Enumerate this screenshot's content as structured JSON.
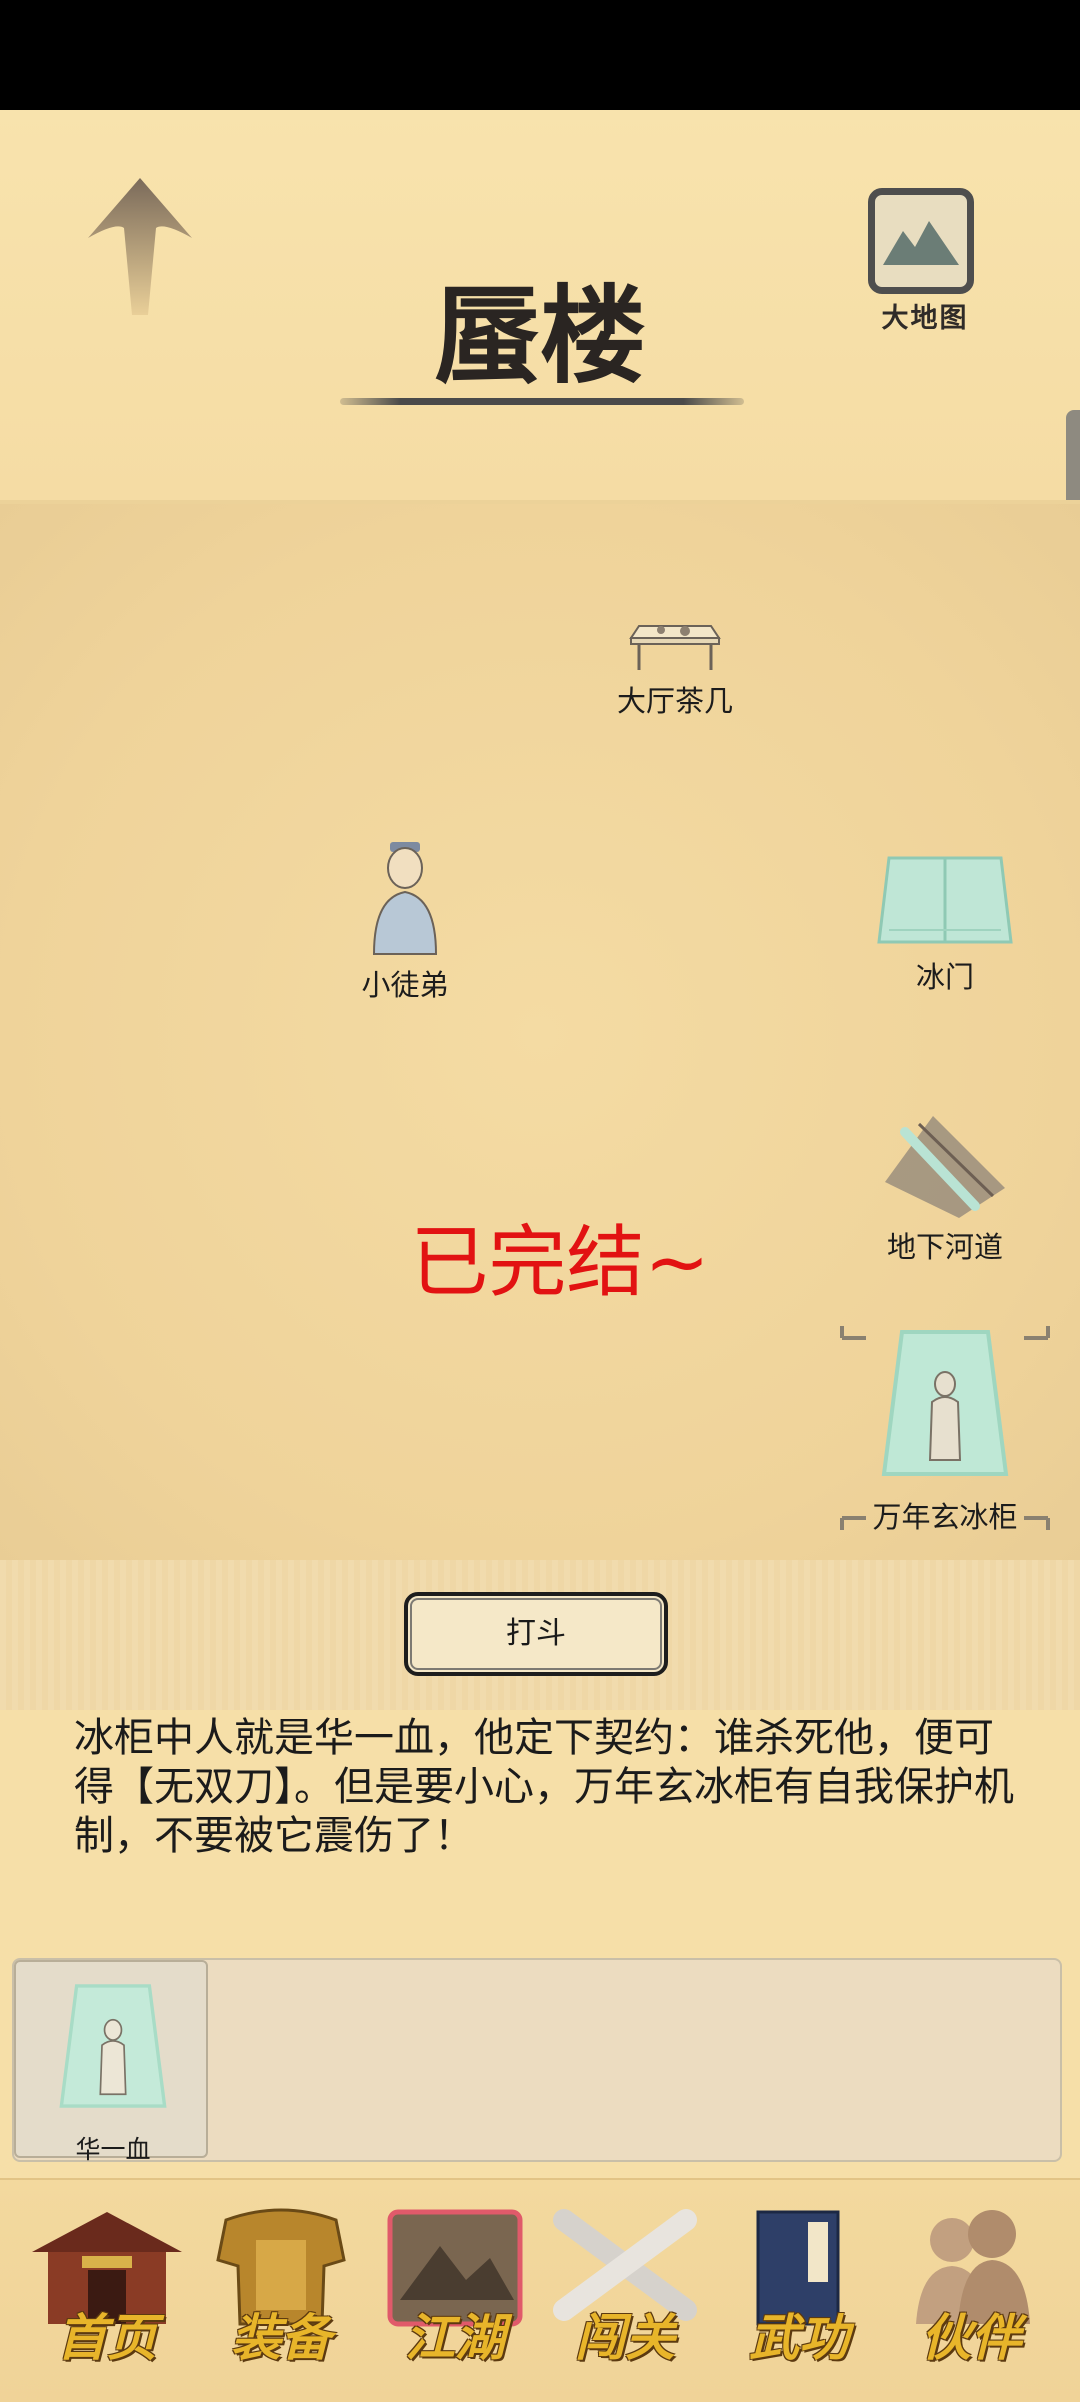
{
  "header": {
    "title": "蜃楼",
    "map_label": "大地图"
  },
  "scene": {
    "objects": [
      {
        "label": "大厅茶几",
        "icon": "tea-table-icon"
      },
      {
        "label": "小徒弟",
        "icon": "apprentice-icon"
      },
      {
        "label": "冰门",
        "icon": "ice-door-icon"
      },
      {
        "label": "地下河道",
        "icon": "underground-river-icon"
      },
      {
        "label": "万年玄冰柜",
        "icon": "ice-cabinet-icon"
      }
    ],
    "status_text": "已完结~"
  },
  "action": {
    "fight_label": "打斗"
  },
  "description": "冰柜中人就是华一血，他定下契约：谁杀死他，便可得【无双刀】。但是要小心，万年玄冰柜有自我保护机制，不要被它震伤了！",
  "tray": {
    "items": [
      {
        "label": "华一血",
        "icon": "ice-cabinet-icon"
      }
    ]
  },
  "nav": {
    "items": [
      {
        "label": "首页"
      },
      {
        "label": "装备"
      },
      {
        "label": "江湖"
      },
      {
        "label": "闯关"
      },
      {
        "label": "武功"
      },
      {
        "label": "伙伴"
      }
    ]
  },
  "colors": {
    "status_red": "#e21212",
    "nav_gold": "#e8b52a",
    "background": "#f6dfa8"
  }
}
